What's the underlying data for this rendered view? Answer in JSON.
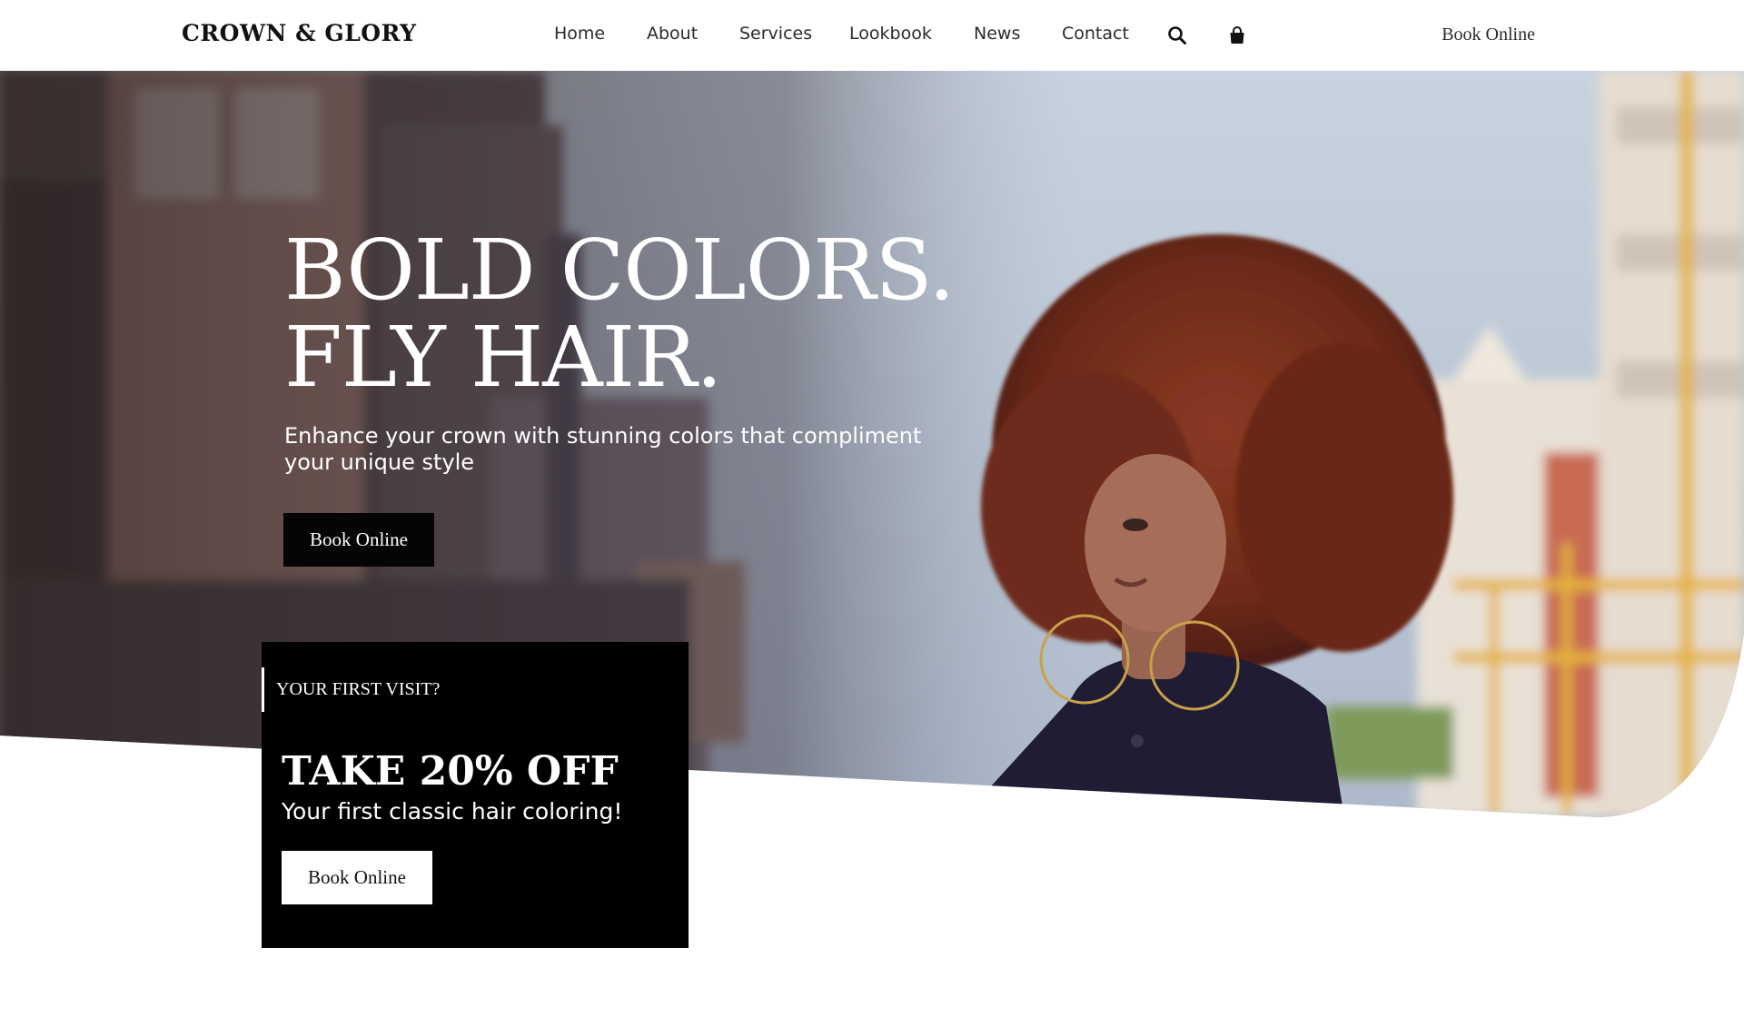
{
  "brand": {
    "logo_text": "CROWN & GLORY"
  },
  "nav": {
    "items": [
      {
        "label": "Home"
      },
      {
        "label": "About"
      },
      {
        "label": "Services"
      },
      {
        "label": "Lookbook"
      },
      {
        "label": "News"
      },
      {
        "label": "Contact"
      }
    ],
    "icons": [
      "search-icon",
      "shopping-bag-icon"
    ],
    "book_label": "Book Online"
  },
  "hero": {
    "title_line1": "BOLD COLORS.",
    "title_line2": "FLY HAIR.",
    "subtitle": "Enhance your crown with stunning colors that compliment your unique style",
    "button_label": "Book Online"
  },
  "promo": {
    "kicker": "YOUR FIRST VISIT?",
    "offer": "TAKE 20% OFF",
    "description": "Your first classic hair coloring!",
    "button_label": "Book Online"
  },
  "colors": {
    "primary": "#000000",
    "background": "#ffffff",
    "text_light": "#ffffff",
    "hair_accent": "#7a2e1d"
  }
}
